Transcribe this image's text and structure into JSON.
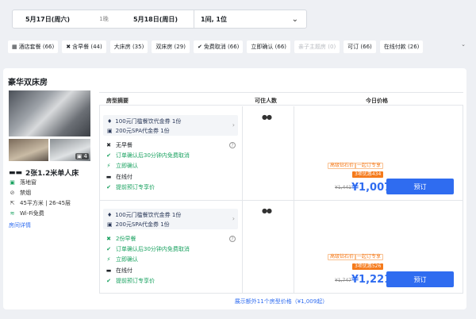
{
  "search": {
    "checkin": "5月17日(周六)",
    "nights": "1晚",
    "checkout": "5月18日(周日)",
    "guests": "1间, 1位"
  },
  "filters": [
    {
      "label": "酒店套餐 (66)",
      "icon": "grid-icon",
      "disabled": false
    },
    {
      "label": "含早餐 (44)",
      "icon": "utensils-icon",
      "disabled": false
    },
    {
      "label": "大床房 (35)",
      "icon": "",
      "disabled": false
    },
    {
      "label": "双床房 (29)",
      "icon": "",
      "disabled": false
    },
    {
      "label": "免费取消 (66)",
      "icon": "check-circle-icon",
      "disabled": false
    },
    {
      "label": "立即确认 (66)",
      "icon": "",
      "disabled": false
    },
    {
      "label": "亲子主题房 (0)",
      "icon": "",
      "disabled": true
    },
    {
      "label": "可订 (66)",
      "icon": "",
      "disabled": false
    },
    {
      "label": "在线付款 (26)",
      "icon": "",
      "disabled": false
    }
  ],
  "room": {
    "title": "豪华双床房",
    "photo_count": "4",
    "bed": "2张1.2米单人床",
    "facilities": [
      "落地窗",
      "禁烟",
      "45平方米 | 26-45层",
      "Wi-Fi免费"
    ],
    "details_link": "房间详情"
  },
  "table": {
    "col_summary": "房型摘要",
    "col_occupancy": "可住人数",
    "col_price": "今日价格"
  },
  "offers": [
    {
      "perk1": "100元门槛餐饮代金券 1份",
      "perk2": "200元SPA代金券 1份",
      "meal": "无早餐",
      "cancel": "订单确认后30分钟内免费取消",
      "confirm": "立即确认",
      "payment": "在线付",
      "early": "提前预订专享价",
      "occupancy": "2",
      "tag1": "高级钻石价",
      "tag2": "一起订专享",
      "discount": "3项优惠434",
      "old_price": "¥1,441",
      "price": "¥1,007",
      "book": "预订"
    },
    {
      "perk1": "100元门槛餐饮代金券 1份",
      "perk2": "200元SPA代金券 1份",
      "meal": "2份早餐",
      "cancel": "订单确认后30分钟内免费取消",
      "confirm": "立即确认",
      "payment": "在线付",
      "early": "提前预订专享价",
      "occupancy": "2",
      "tag1": "高级钻石价",
      "tag2": "一起订专享",
      "discount": "3项优惠526",
      "old_price": "¥1,747",
      "price": "¥1,221",
      "book": "预订"
    }
  ],
  "more_link": "展示额外11个房型价格（¥1,009起）",
  "colors": {
    "accent": "#2f6cf0",
    "orange": "#f57a1b",
    "green": "#1aa260"
  }
}
